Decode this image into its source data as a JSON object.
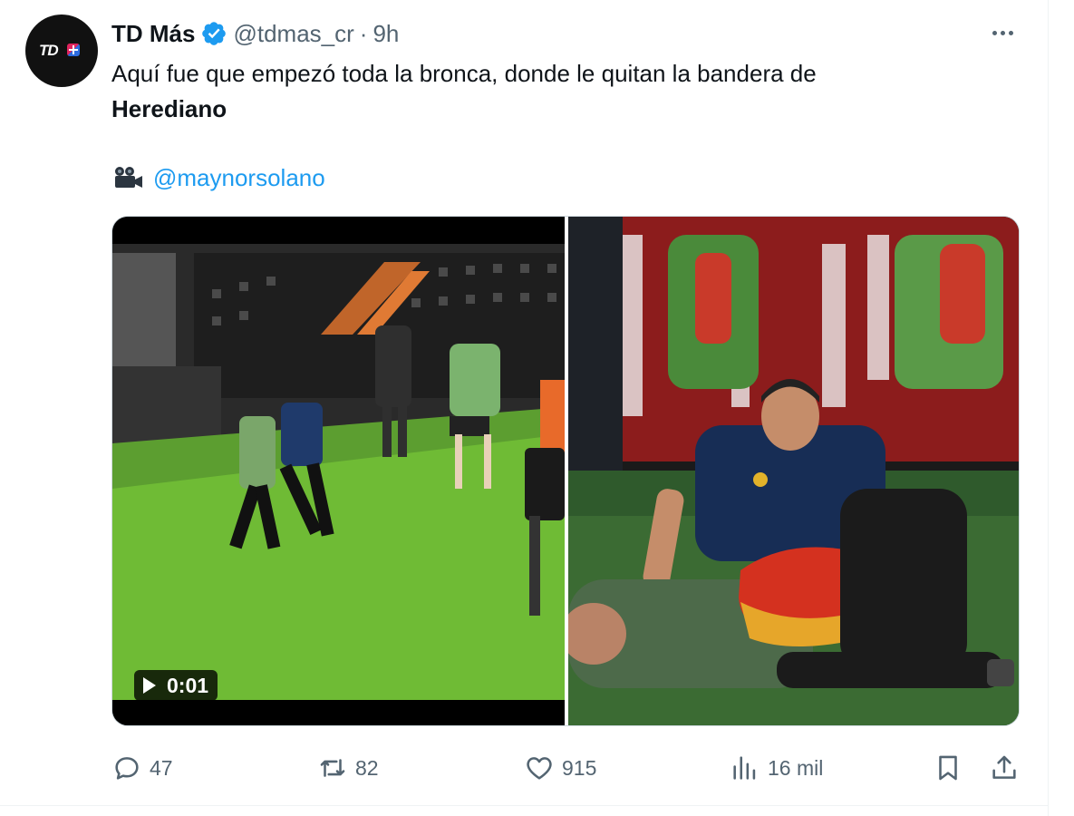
{
  "author": {
    "display_name": "TD Más",
    "handle": "@tdmas_cr",
    "separator": "·",
    "time": "9h",
    "avatar_logo_text": "TD",
    "verified_color": "#1d9bf0"
  },
  "tweet": {
    "text_line": "Aquí fue que empezó toda la bronca, donde le quitan la bandera de",
    "text_bold": "Herediano",
    "credit_icon": "movie-camera-icon",
    "credit_mention": "@maynorsolano"
  },
  "media": {
    "video_duration": "0:01",
    "play_icon": "play-icon"
  },
  "actions": {
    "replies": "47",
    "reposts": "82",
    "likes": "915",
    "views": "16 mil"
  },
  "colors": {
    "text_primary": "#0f1419",
    "text_secondary": "#536471",
    "accent": "#1d9bf0"
  }
}
